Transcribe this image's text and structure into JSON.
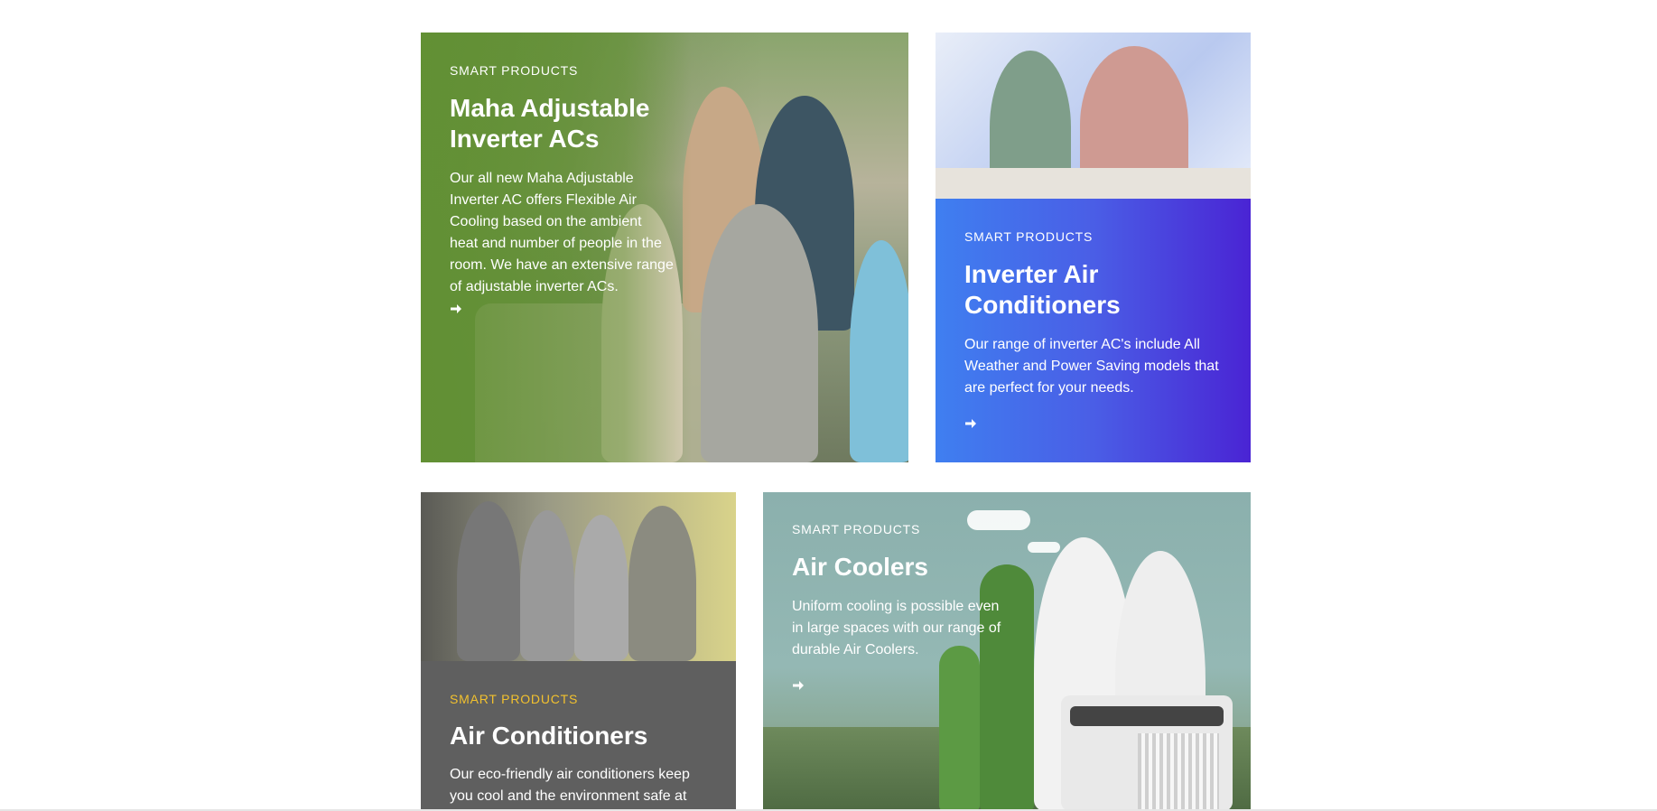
{
  "cards": {
    "maha": {
      "eyebrow": "SMART PRODUCTS",
      "title_line1": "Maha Adjustable",
      "title_line2": "Inverter ACs",
      "desc_lines": [
        "Our all new Maha Adjustable",
        "Inverter AC offers Flexible Air",
        "Cooling based on the ambient",
        "heat and number of people in the",
        "room. We have an extensive range",
        "of adjustable inverter ACs."
      ],
      "arrow_icon": "arrow-right-icon"
    },
    "inverter": {
      "eyebrow": "SMART PRODUCTS",
      "title_line1": "Inverter Air",
      "title_line2": "Conditioners",
      "desc_lines": [
        "Our range of inverter AC's include All",
        "Weather and Power Saving models that",
        "are perfect for your needs."
      ],
      "arrow_icon": "arrow-right-icon"
    },
    "ac": {
      "eyebrow": "SMART PRODUCTS",
      "title": "Air Conditioners",
      "desc_lines": [
        "Our eco-friendly air conditioners keep",
        "you cool and the environment safe at"
      ],
      "eyebrow_color": "#f2c12e"
    },
    "coolers": {
      "eyebrow": "SMART PRODUCTS",
      "title": "Air Coolers",
      "desc_lines": [
        "Uniform cooling is possible even",
        "in large spaces with our range of",
        "durable Air Coolers."
      ],
      "arrow_icon": "arrow-right-icon"
    }
  },
  "colors": {
    "maha_green": "#6a9a3c",
    "inverter_blue": "#3f7ff0",
    "inverter_purple": "#4a24d4",
    "ac_gray": "#5f5f5f",
    "coolers_teal": "#8bb0ad",
    "ac_eyebrow_yellow": "#f2c12e"
  }
}
